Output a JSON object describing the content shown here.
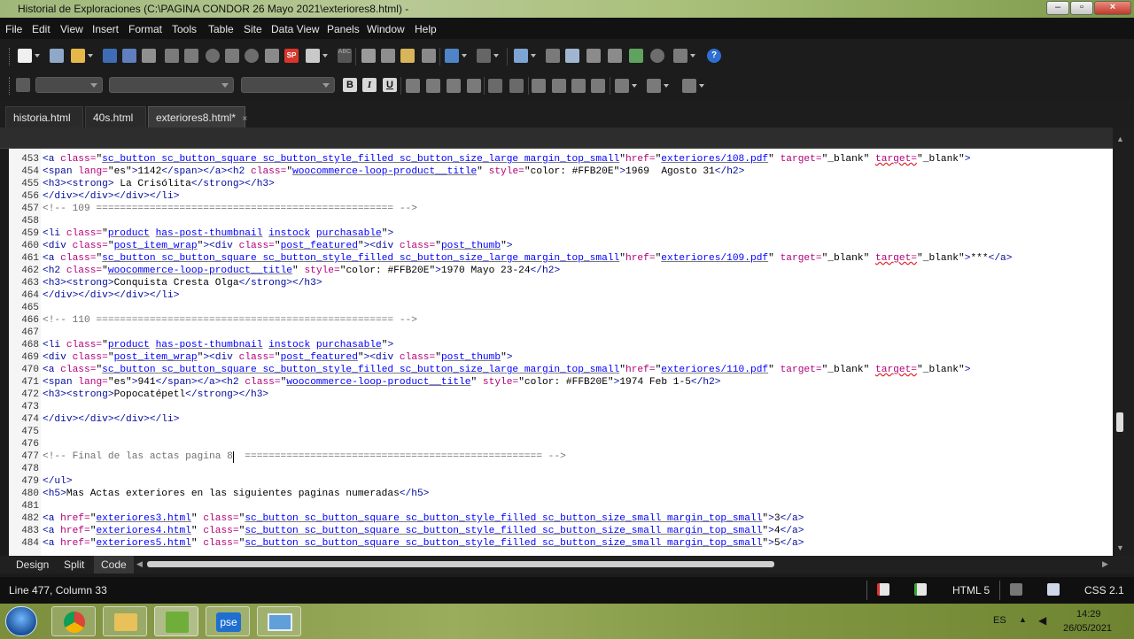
{
  "window": {
    "title": "Historial de Exploraciones (C:\\PAGINA CONDOR 26 Mayo  2021\\exteriores8.html) -"
  },
  "menu": [
    "File",
    "Edit",
    "View",
    "Insert",
    "Format",
    "Tools",
    "Table",
    "Site",
    "Data View",
    "Panels",
    "Window",
    "Help"
  ],
  "tabs": [
    {
      "label": "historia.html",
      "active": false
    },
    {
      "label": "40s.html",
      "active": false
    },
    {
      "label": "exteriores8.html*",
      "active": true,
      "close": "×"
    }
  ],
  "format_buttons": {
    "bold": "B",
    "italic": "I",
    "underline": "U"
  },
  "toolbar_icons": [
    "new-file-icon",
    "open-folder-icon",
    "save-icon",
    "save-all-icon",
    "find-icon",
    "print-icon",
    "spellcheck-icon",
    "cut-icon",
    "copy-icon",
    "paste-icon",
    "undo-icon",
    "redo-icon",
    "table-icon",
    "image-icon",
    "help-icon"
  ],
  "code_lines": [
    {
      "n": "453",
      "segs": [
        [
          "t",
          "<a "
        ],
        [
          "a",
          "class="
        ],
        [
          "p",
          "\""
        ],
        [
          "v",
          "sc_button sc_button_square sc_button_style_filled sc_button_size_large margin_top_small"
        ],
        [
          "p",
          "\""
        ],
        [
          "a",
          "href="
        ],
        [
          "p",
          "\""
        ],
        [
          "v",
          "exteriores/108.pdf"
        ],
        [
          "p",
          "\" "
        ],
        [
          "a",
          "target="
        ],
        [
          "p",
          "\"_blank\" "
        ],
        [
          "w",
          "target="
        ],
        [
          "p",
          "\"_blank\""
        ],
        [
          "t",
          ">"
        ]
      ]
    },
    {
      "n": "454",
      "segs": [
        [
          "t",
          "<span "
        ],
        [
          "a",
          "lang="
        ],
        [
          "p",
          "\"es\""
        ],
        [
          "t",
          ">"
        ],
        [
          "p",
          "1142"
        ],
        [
          "t",
          "</span></a><h2 "
        ],
        [
          "a",
          "class="
        ],
        [
          "p",
          "\""
        ],
        [
          "v",
          "woocommerce-loop-product__title"
        ],
        [
          "p",
          "\" "
        ],
        [
          "a",
          "style="
        ],
        [
          "p",
          "\"color: #FFB20E\""
        ],
        [
          "t",
          ">"
        ],
        [
          "p",
          "1969  Agosto 31"
        ],
        [
          "t",
          "</h2>"
        ]
      ]
    },
    {
      "n": "455",
      "segs": [
        [
          "t",
          "<h3><strong>"
        ],
        [
          "p",
          " La Crisólita"
        ],
        [
          "t",
          "</strong></h3>"
        ]
      ]
    },
    {
      "n": "456",
      "segs": [
        [
          "t",
          "</div></div></div></li>"
        ]
      ]
    },
    {
      "n": "457",
      "segs": [
        [
          "c",
          "<!-- 109 ================================================== -->"
        ]
      ]
    },
    {
      "n": "458",
      "segs": []
    },
    {
      "n": "459",
      "segs": [
        [
          "t",
          "<li "
        ],
        [
          "a",
          "class="
        ],
        [
          "p",
          "\""
        ],
        [
          "v",
          "product"
        ],
        [
          "p",
          " "
        ],
        [
          "v",
          "has-post-thumbnail"
        ],
        [
          "p",
          " "
        ],
        [
          "v",
          "instock"
        ],
        [
          "p",
          " "
        ],
        [
          "v",
          "purchasable"
        ],
        [
          "p",
          "\""
        ],
        [
          "t",
          ">"
        ]
      ]
    },
    {
      "n": "460",
      "segs": [
        [
          "t",
          "<div "
        ],
        [
          "a",
          "class="
        ],
        [
          "p",
          "\""
        ],
        [
          "v",
          "post_item_wrap"
        ],
        [
          "p",
          "\""
        ],
        [
          "t",
          "><div "
        ],
        [
          "a",
          "class="
        ],
        [
          "p",
          "\""
        ],
        [
          "v",
          "post_featured"
        ],
        [
          "p",
          "\""
        ],
        [
          "t",
          "><div "
        ],
        [
          "a",
          "class="
        ],
        [
          "p",
          "\""
        ],
        [
          "v",
          "post_thumb"
        ],
        [
          "p",
          "\""
        ],
        [
          "t",
          ">"
        ]
      ]
    },
    {
      "n": "461",
      "segs": [
        [
          "t",
          "<a "
        ],
        [
          "a",
          "class="
        ],
        [
          "p",
          "\""
        ],
        [
          "v",
          "sc_button sc_button_square sc_button_style_filled sc_button_size_large margin_top_small"
        ],
        [
          "p",
          "\""
        ],
        [
          "a",
          "href="
        ],
        [
          "p",
          "\""
        ],
        [
          "v",
          "exteriores/109.pdf"
        ],
        [
          "p",
          "\" "
        ],
        [
          "a",
          "target="
        ],
        [
          "p",
          "\"_blank\" "
        ],
        [
          "w",
          "target="
        ],
        [
          "p",
          "\"_blank\""
        ],
        [
          "t",
          ">"
        ],
        [
          "p",
          "***"
        ],
        [
          "t",
          "</a>"
        ]
      ]
    },
    {
      "n": "462",
      "segs": [
        [
          "t",
          "<h2 "
        ],
        [
          "a",
          "class="
        ],
        [
          "p",
          "\""
        ],
        [
          "v",
          "woocommerce-loop-product__title"
        ],
        [
          "p",
          "\" "
        ],
        [
          "a",
          "style="
        ],
        [
          "p",
          "\"color: #FFB20E\""
        ],
        [
          "t",
          ">"
        ],
        [
          "p",
          "1970 Mayo 23-24"
        ],
        [
          "t",
          "</h2>"
        ]
      ]
    },
    {
      "n": "463",
      "segs": [
        [
          "t",
          "<h3><strong>"
        ],
        [
          "p",
          "Conquista Cresta Olga"
        ],
        [
          "t",
          "</strong></h3>"
        ]
      ]
    },
    {
      "n": "464",
      "segs": [
        [
          "t",
          "</div></div></div></li>"
        ]
      ]
    },
    {
      "n": "465",
      "segs": []
    },
    {
      "n": "466",
      "segs": [
        [
          "c",
          "<!-- 110 ================================================== -->"
        ]
      ]
    },
    {
      "n": "467",
      "segs": []
    },
    {
      "n": "468",
      "segs": [
        [
          "t",
          "<li "
        ],
        [
          "a",
          "class="
        ],
        [
          "p",
          "\""
        ],
        [
          "v",
          "product"
        ],
        [
          "p",
          " "
        ],
        [
          "v",
          "has-post-thumbnail"
        ],
        [
          "p",
          " "
        ],
        [
          "v",
          "instock"
        ],
        [
          "p",
          " "
        ],
        [
          "v",
          "purchasable"
        ],
        [
          "p",
          "\""
        ],
        [
          "t",
          ">"
        ]
      ]
    },
    {
      "n": "469",
      "segs": [
        [
          "t",
          "<div "
        ],
        [
          "a",
          "class="
        ],
        [
          "p",
          "\""
        ],
        [
          "v",
          "post_item_wrap"
        ],
        [
          "p",
          "\""
        ],
        [
          "t",
          "><div "
        ],
        [
          "a",
          "class="
        ],
        [
          "p",
          "\""
        ],
        [
          "v",
          "post_featured"
        ],
        [
          "p",
          "\""
        ],
        [
          "t",
          "><div "
        ],
        [
          "a",
          "class="
        ],
        [
          "p",
          "\""
        ],
        [
          "v",
          "post_thumb"
        ],
        [
          "p",
          "\""
        ],
        [
          "t",
          ">"
        ]
      ]
    },
    {
      "n": "470",
      "segs": [
        [
          "t",
          "<a "
        ],
        [
          "a",
          "class="
        ],
        [
          "p",
          "\""
        ],
        [
          "v",
          "sc_button sc_button_square sc_button_style_filled sc_button_size_large margin_top_small"
        ],
        [
          "p",
          "\""
        ],
        [
          "a",
          "href="
        ],
        [
          "p",
          "\""
        ],
        [
          "v",
          "exteriores/110.pdf"
        ],
        [
          "p",
          "\" "
        ],
        [
          "a",
          "target="
        ],
        [
          "p",
          "\"_blank\" "
        ],
        [
          "w",
          "target="
        ],
        [
          "p",
          "\"_blank\""
        ],
        [
          "t",
          ">"
        ]
      ]
    },
    {
      "n": "471",
      "segs": [
        [
          "t",
          "<span "
        ],
        [
          "a",
          "lang="
        ],
        [
          "p",
          "\"es\""
        ],
        [
          "t",
          ">"
        ],
        [
          "p",
          "941"
        ],
        [
          "t",
          "</span></a><h2 "
        ],
        [
          "a",
          "class="
        ],
        [
          "p",
          "\""
        ],
        [
          "v",
          "woocommerce-loop-product__title"
        ],
        [
          "p",
          "\" "
        ],
        [
          "a",
          "style="
        ],
        [
          "p",
          "\"color: #FFB20E\""
        ],
        [
          "t",
          ">"
        ],
        [
          "p",
          "1974 Feb 1-5"
        ],
        [
          "t",
          "</h2>"
        ]
      ]
    },
    {
      "n": "472",
      "segs": [
        [
          "t",
          "<h3><strong>"
        ],
        [
          "p",
          "Popocatépetl"
        ],
        [
          "t",
          "</strong></h3>"
        ]
      ]
    },
    {
      "n": "473",
      "segs": []
    },
    {
      "n": "474",
      "segs": [
        [
          "t",
          "</div></div></div></li>"
        ]
      ]
    },
    {
      "n": "475",
      "segs": []
    },
    {
      "n": "476",
      "segs": []
    },
    {
      "n": "477",
      "segs": [
        [
          "c",
          "<!-- Final de las actas pagina 8  ================================================== -->"
        ]
      ]
    },
    {
      "n": "478",
      "segs": []
    },
    {
      "n": "479",
      "segs": [
        [
          "t",
          "</ul>"
        ]
      ]
    },
    {
      "n": "480",
      "segs": [
        [
          "t",
          "<h5>"
        ],
        [
          "p",
          "Mas Actas exteriores en las siguientes paginas numeradas"
        ],
        [
          "t",
          "</h5>"
        ]
      ]
    },
    {
      "n": "481",
      "segs": []
    },
    {
      "n": "482",
      "segs": [
        [
          "t",
          "<a "
        ],
        [
          "a",
          "href="
        ],
        [
          "p",
          "\""
        ],
        [
          "v",
          "exteriores3.html"
        ],
        [
          "p",
          "\" "
        ],
        [
          "a",
          "class="
        ],
        [
          "p",
          "\""
        ],
        [
          "v",
          "sc_button sc_button_square sc_button_style_filled sc_button_size_small margin_top_small"
        ],
        [
          "p",
          "\""
        ],
        [
          "t",
          ">"
        ],
        [
          "p",
          "3"
        ],
        [
          "t",
          "</a>"
        ]
      ]
    },
    {
      "n": "483",
      "segs": [
        [
          "t",
          "<a "
        ],
        [
          "a",
          "href="
        ],
        [
          "p",
          "\""
        ],
        [
          "v",
          "exteriores4.html"
        ],
        [
          "p",
          "\" "
        ],
        [
          "a",
          "class="
        ],
        [
          "p",
          "\""
        ],
        [
          "v",
          "sc_button sc_button_square sc_button_style_filled sc_button_size_small margin_top_small"
        ],
        [
          "p",
          "\""
        ],
        [
          "t",
          ">"
        ],
        [
          "p",
          "4"
        ],
        [
          "t",
          "</a>"
        ]
      ]
    },
    {
      "n": "484",
      "segs": [
        [
          "t",
          "<a "
        ],
        [
          "a",
          "href="
        ],
        [
          "p",
          "\""
        ],
        [
          "v",
          "exteriores5.html"
        ],
        [
          "p",
          "\" "
        ],
        [
          "a",
          "class="
        ],
        [
          "p",
          "\""
        ],
        [
          "v",
          "sc_button sc_button_square sc_button_style_filled sc_button_size_small margin_top_small"
        ],
        [
          "p",
          "\""
        ],
        [
          "t",
          ">"
        ],
        [
          "p",
          "5"
        ],
        [
          "t",
          "</a>"
        ]
      ]
    }
  ],
  "views": {
    "design": "Design",
    "split": "Split",
    "code": "Code"
  },
  "status": {
    "position": "Line 477, Column 33",
    "doctype": "HTML 5",
    "css": "CSS 2.1"
  },
  "taskbar": {
    "lang": "ES",
    "time": "14:29",
    "date": "26/05/2021",
    "pse_label": "pse"
  }
}
